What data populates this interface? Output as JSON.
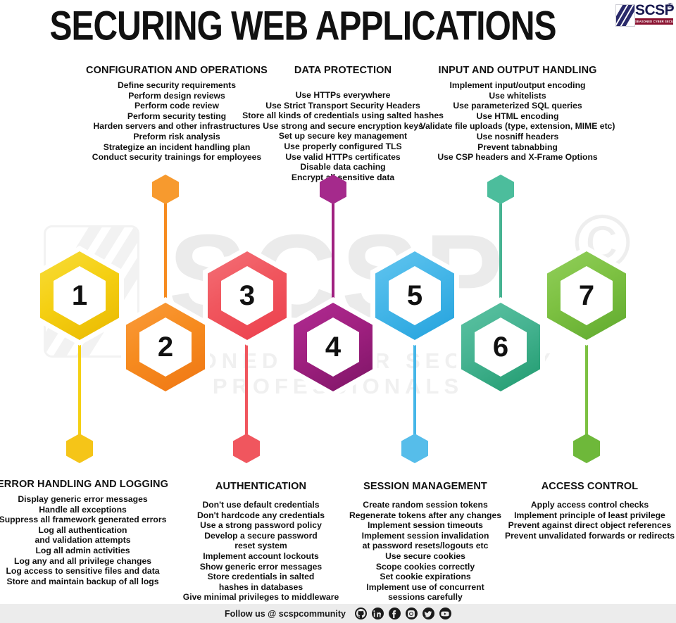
{
  "header": {
    "title": "SECURING WEB APPLICATIONS",
    "logo": {
      "name": "SCSP",
      "copyright": "©",
      "tagline": "SEASONED CYBER SECURITY PROFESSIONALS"
    }
  },
  "watermark": {
    "text": "SCSP",
    "subtitle": "SEASONED CYBER SECURITY PROFESSIONALS",
    "copyright": "©"
  },
  "top_blocks": [
    {
      "heading": "CONFIGURATION AND OPERATIONS",
      "items": [
        "Define security requirements",
        "Perform design reviews",
        "Perform code review",
        "Perform security testing",
        "Harden servers and other infrastructures",
        "Preform risk analysis",
        "Strategize an incident handling plan",
        "Conduct security trainings for employees"
      ]
    },
    {
      "heading": "DATA PROTECTION",
      "items": [
        "Use HTTPs everywhere",
        "Use Strict Transport Security Headers",
        "Store all kinds of credentials using salted hashes",
        "Use strong and secure encryption keys",
        "Set up secure key management",
        "Use properly configured TLS",
        "Use valid HTTPs certificates",
        "Disable data caching",
        "Encrypt all sensitive data"
      ]
    },
    {
      "heading": "INPUT AND OUTPUT HANDLING",
      "items": [
        "Implement input/output encoding",
        "Use whitelists",
        "Use parameterized SQL queries",
        "Use HTML encoding",
        "Validate file uploads (type, extension, MIME etc)",
        "Use nosniff headers",
        "Prevent tabnabbing",
        "Use CSP headers and X-Frame Options"
      ]
    }
  ],
  "bottom_blocks": [
    {
      "heading": "ERROR HANDLING AND LOGGING",
      "items": [
        "Display generic error messages",
        "Handle all exceptions",
        "Suppress all framework generated errors",
        "Log all authentication",
        "and validation attempts",
        "Log all admin activities",
        "Log any and all privilege changes",
        "Log access to sensitive files and data",
        "Store and maintain backup of all logs"
      ]
    },
    {
      "heading": "AUTHENTICATION",
      "items": [
        "Don't use default credentials",
        "Don't hardcode any credentials",
        "Use a strong password policy",
        "Develop a secure password",
        "reset system",
        "Implement account lockouts",
        "Show generic error messages",
        "Store credentials in salted",
        "hashes in databases",
        "Give minimal privileges to middleware"
      ]
    },
    {
      "heading": "SESSION MANAGEMENT",
      "items": [
        "Create random session tokens",
        "Regenerate tokens after any changes",
        "Implement session timeouts",
        "Implement session invalidation",
        "at password resets/logouts etc",
        "Use secure cookies",
        "Scope cookies correctly",
        "Set cookie expirations",
        "Implement use of concurrent",
        "sessions carefully"
      ]
    },
    {
      "heading": "ACCESS CONTROL",
      "items": [
        "Apply access control checks",
        "Implement principle of least privilege",
        "Prevent against direct object references",
        "Prevent unvalidated forwards or redirects"
      ]
    }
  ],
  "hexagons": [
    {
      "number": "1",
      "color": "#f5d013",
      "color_dark": "#e9b800",
      "position": "up"
    },
    {
      "number": "2",
      "color": "#f68b1f",
      "color_dark": "#ef7613",
      "position": "down"
    },
    {
      "number": "3",
      "color": "#f0565e",
      "color_dark": "#ec3f4d",
      "position": "up"
    },
    {
      "number": "4",
      "color": "#a02080",
      "color_dark": "#7d1566",
      "position": "down"
    },
    {
      "number": "5",
      "color": "#45b6e8",
      "color_dark": "#23a2dd",
      "position": "up"
    },
    {
      "number": "6",
      "color": "#46b391",
      "color_dark": "#1f9a6e",
      "position": "down"
    },
    {
      "number": "7",
      "color": "#7dc142",
      "color_dark": "#5fa92e",
      "position": "up"
    }
  ],
  "footer": {
    "follow_text": "Follow us @ scspcommunity",
    "social": [
      {
        "name": "github",
        "glyph": "github-icon"
      },
      {
        "name": "linkedin",
        "glyph": "linkedin-icon"
      },
      {
        "name": "facebook",
        "glyph": "facebook-icon"
      },
      {
        "name": "instagram",
        "glyph": "instagram-icon"
      },
      {
        "name": "twitter",
        "glyph": "twitter-icon"
      },
      {
        "name": "youtube",
        "glyph": "youtube-icon"
      }
    ]
  }
}
